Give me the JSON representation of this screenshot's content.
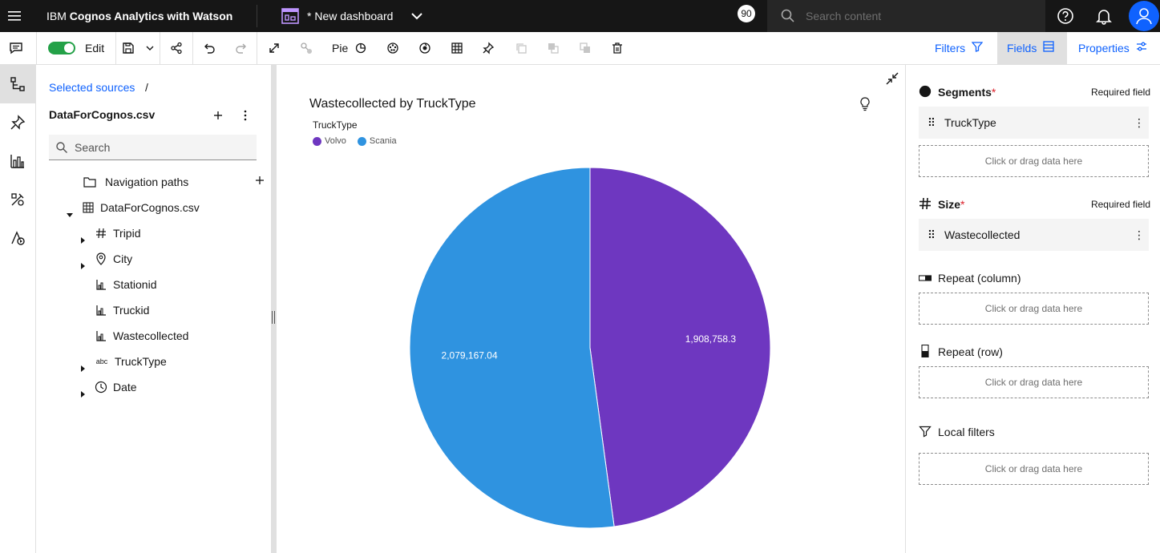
{
  "topbar": {
    "brand_prefix": "IBM ",
    "brand_name": "Cognos Analytics with Watson",
    "dashboard_name": "* New dashboard",
    "badge_count": "90",
    "search_placeholder": "Search content"
  },
  "toolbar": {
    "edit_label": "Edit",
    "chart_type_label": "Pie",
    "filters_label": "Filters",
    "fields_label": "Fields",
    "properties_label": "Properties"
  },
  "sources": {
    "breadcrumb": "Selected sources",
    "breadcrumb_sep": "/",
    "source_name": "DataForCognos.csv",
    "search_placeholder": "Search",
    "tree": [
      {
        "label": "Navigation paths",
        "icon": "folder-icon"
      },
      {
        "label": "DataForCognos.csv",
        "icon": "table-icon"
      },
      {
        "label": "Tripid",
        "icon": "hash-icon"
      },
      {
        "label": "City",
        "icon": "location-icon"
      },
      {
        "label": "Stationid",
        "icon": "measure-icon"
      },
      {
        "label": "Truckid",
        "icon": "measure-icon"
      },
      {
        "label": "Wastecollected",
        "icon": "measure-icon"
      },
      {
        "label": "TruckType",
        "icon": "text-icon",
        "icon_text": "abc"
      },
      {
        "label": "Date",
        "icon": "clock-icon"
      }
    ]
  },
  "chart_data": {
    "type": "pie",
    "title": "Wastecollected by TruckType",
    "legend_title": "TruckType",
    "legend_position": "top-left",
    "categories": [
      "Volvo",
      "Scania"
    ],
    "values": [
      1908758.3,
      2079167.04
    ],
    "value_labels": [
      "1,908,758.3",
      "2,079,167.04"
    ],
    "colors": [
      "#6e37c0",
      "#2f93e0"
    ]
  },
  "fields_panel": {
    "segments_label": "Segments",
    "size_label": "Size",
    "required_note": "Required field",
    "segments_value": "TruckType",
    "size_value": "Wastecollected",
    "repeat_column_label": "Repeat (column)",
    "repeat_row_label": "Repeat (row)",
    "local_filters_label": "Local filters",
    "dropzone_text": "Click or drag data here",
    "required_star": "*",
    "more_glyph": "⋮",
    "drag_glyph": "⠿"
  }
}
